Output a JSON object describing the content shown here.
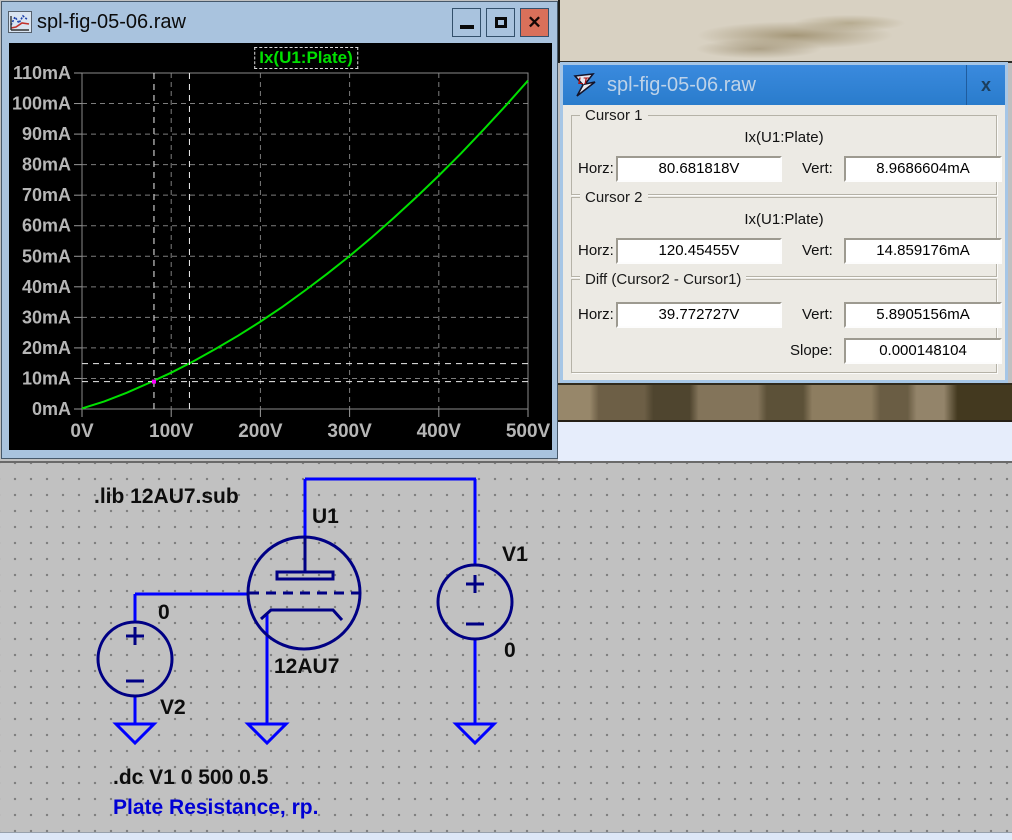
{
  "desktop": {
    "wallpaper_tan": "#d8d1c2",
    "wood_band": "#83745a",
    "pale_strip": "#e6edfb"
  },
  "plot_window": {
    "title": "spl-fig-05-06.raw",
    "close_glyph": "✕"
  },
  "chart_data": {
    "type": "line",
    "title": "Ix(U1:Plate)",
    "xlabel": "",
    "ylabel": "",
    "x_unit": "V",
    "y_unit": "mA",
    "xlim": [
      0,
      500
    ],
    "ylim": [
      0,
      110
    ],
    "grid": true,
    "background": "#000000",
    "x_ticks": [
      0,
      100,
      200,
      300,
      400,
      500
    ],
    "x_tick_labels": [
      "0V",
      "100V",
      "200V",
      "300V",
      "400V",
      "500V"
    ],
    "y_ticks": [
      0,
      10,
      20,
      30,
      40,
      50,
      60,
      70,
      80,
      90,
      100,
      110
    ],
    "y_tick_labels": [
      "0mA",
      "10mA",
      "20mA",
      "30mA",
      "40mA",
      "50mA",
      "60mA",
      "70mA",
      "80mA",
      "90mA",
      "100mA",
      "110mA"
    ],
    "x": [
      0,
      25,
      50,
      75,
      100,
      125,
      150,
      175,
      200,
      225,
      250,
      275,
      300,
      325,
      350,
      375,
      400,
      425,
      450,
      475,
      500
    ],
    "series": [
      {
        "name": "Ix(U1:Plate)",
        "color": "#00e000",
        "values": [
          0.2,
          2.5,
          5.3,
          8.5,
          11.9,
          15.6,
          19.7,
          24.0,
          28.6,
          33.5,
          38.8,
          44.3,
          50.1,
          56.2,
          62.7,
          69.4,
          76.4,
          83.7,
          91.4,
          99.3,
          107.5
        ]
      }
    ],
    "cursors": {
      "cursor1": {
        "x": 80.681818,
        "y": 8.9686604
      },
      "cursor2": {
        "x": 120.45455,
        "y": 14.859176
      }
    }
  },
  "cursor_dialog": {
    "title": "spl-fig-05-06.raw",
    "close_glyph": "x",
    "cursor1": {
      "legend": "Cursor 1",
      "trace": "Ix(U1:Plate)",
      "horz_label": "Horz:",
      "horz_value": "80.681818V",
      "vert_label": "Vert:",
      "vert_value": "8.9686604mA"
    },
    "cursor2": {
      "legend": "Cursor 2",
      "trace": "Ix(U1:Plate)",
      "horz_label": "Horz:",
      "horz_value": "120.45455V",
      "vert_label": "Vert:",
      "vert_value": "14.859176mA"
    },
    "diff": {
      "legend": "Diff (Cursor2 - Cursor1)",
      "horz_label": "Horz:",
      "horz_value": "39.772727V",
      "vert_label": "Vert:",
      "vert_value": "5.8905156mA",
      "slope_label": "Slope:",
      "slope_value": "0.000148104"
    }
  },
  "schematic": {
    "lib_directive": ".lib 12AU7.sub",
    "dc_directive": ".dc V1 0 500 0.5",
    "comment": "Plate Resistance, rp.",
    "tube": {
      "name": "U1",
      "value": "12AU7"
    },
    "v1": {
      "name": "V1",
      "value": "0"
    },
    "v2": {
      "name": "V2",
      "value": "0"
    },
    "wire_color": "#0000ff",
    "symbol_color": "#000084",
    "comment_color": "#0000d4"
  }
}
